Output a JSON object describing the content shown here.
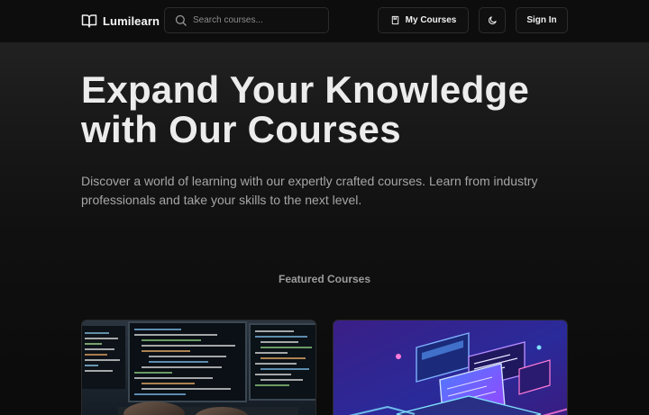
{
  "app": {
    "brand_name": "Lumilearn",
    "brand_icon": "open-book-icon"
  },
  "nav": {
    "search_placeholder": "Search courses...",
    "my_courses_label": "My Courses",
    "my_courses_icon": "bookmark-book-icon",
    "theme_icon": "moon-icon",
    "sign_in_label": "Sign In"
  },
  "hero": {
    "title_line1": "Expand Your Knowledge",
    "title_line2": "with Our Courses",
    "subtitle": "Discover a world of learning with our expertly crafted courses. Learn from industry professionals and take your skills to the next level."
  },
  "featured": {
    "section_title": "Featured Courses",
    "cards": [
      {
        "image": "code-on-monitors-image"
      },
      {
        "image": "isometric-laptop-neon-image"
      }
    ]
  },
  "colors": {
    "background": "#0c0c0c",
    "nav_background": "#0d0d0d",
    "border": "#2c2c2c",
    "title_text": "#ececec",
    "muted_text": "#a6a6a6"
  }
}
